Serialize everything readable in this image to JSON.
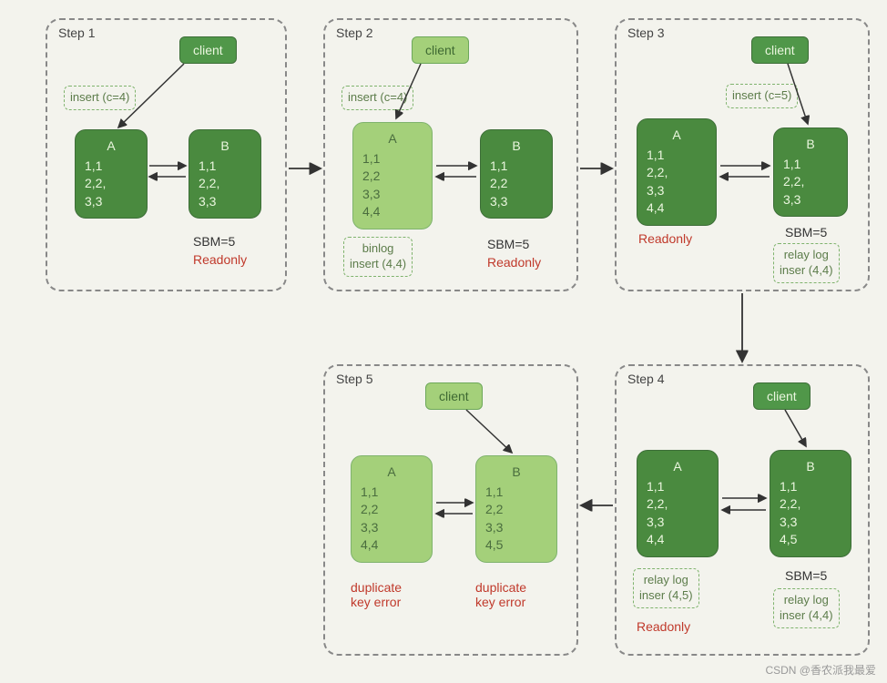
{
  "labels": {
    "client": "client",
    "sbm": "SBM=5",
    "readonly": "Readonly"
  },
  "watermark": "CSDN @香农派我最爱",
  "steps": {
    "s1": {
      "title": "Step 1",
      "insert": "insert (c=4)",
      "A": {
        "name": "A",
        "rows": "1,1\n2,2,\n3,3"
      },
      "B": {
        "name": "B",
        "rows": "1,1\n2,2,\n3,3"
      }
    },
    "s2": {
      "title": "Step 2",
      "insert": "insert (c=4)",
      "A": {
        "name": "A",
        "rows": "1,1\n2,2\n3,3\n4,4"
      },
      "B": {
        "name": "B",
        "rows": "1,1\n2,2\n3,3"
      },
      "binlog": "binlog\ninsert (4,4)"
    },
    "s3": {
      "title": "Step 3",
      "insert": "insert (c=5)",
      "A": {
        "name": "A",
        "rows": "1,1\n2,2,\n3,3\n4,4"
      },
      "B": {
        "name": "B",
        "rows": "1,1\n2,2,\n3,3"
      },
      "relay": "relay log\ninser (4,4)"
    },
    "s4": {
      "title": "Step 4",
      "A": {
        "name": "A",
        "rows": "1,1\n2,2,\n3,3\n4,4"
      },
      "B": {
        "name": "B",
        "rows": "1,1\n2,2,\n3,3\n4,5"
      },
      "relayA": "relay log\ninser (4,5)",
      "relayB": "relay log\ninser (4,4)"
    },
    "s5": {
      "title": "Step 5",
      "A": {
        "name": "A",
        "rows": "1,1\n2,2\n3,3\n4,4"
      },
      "B": {
        "name": "B",
        "rows": "1,1\n2,2\n3,3\n4,5"
      },
      "err": "duplicate\nkey error"
    }
  }
}
